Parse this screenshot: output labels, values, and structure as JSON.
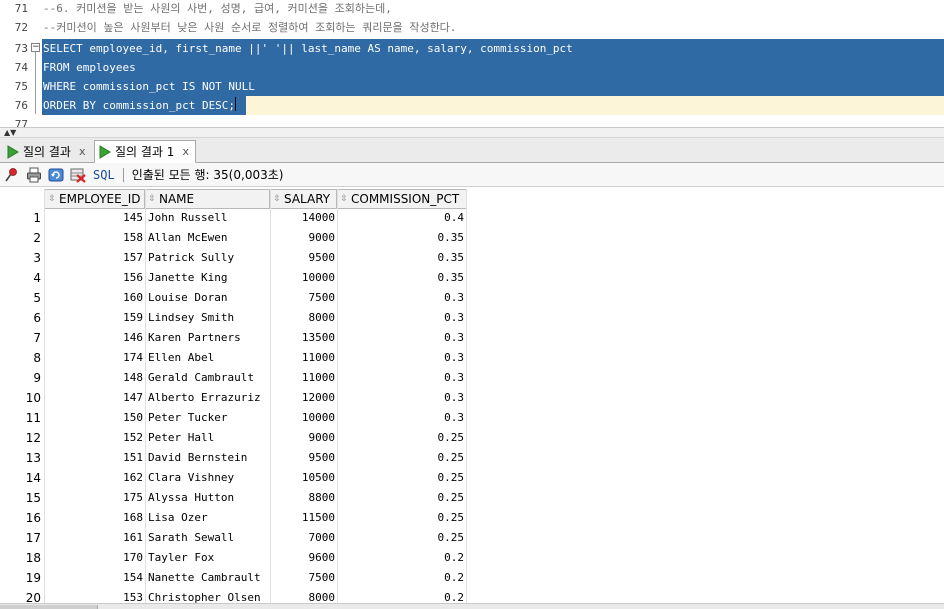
{
  "editor": {
    "lines": [
      {
        "num": "71",
        "text": "--6. 커미션을 받는 사원의 사번, 성명, 급여, 커미션을 조회하는데,",
        "kind": "comment"
      },
      {
        "num": "72",
        "text": "--커미션이 높은 사원부터 낮은 사원 순서로 정렬하여 조회하는 쿼리문을 작성한다.",
        "kind": "comment"
      },
      {
        "num": "73",
        "text": "SELECT employee_id, first_name ||' '|| last_name AS name, salary, commission_pct",
        "kind": "selected"
      },
      {
        "num": "74",
        "text": "FROM employees",
        "kind": "selected"
      },
      {
        "num": "75",
        "text": "WHERE commission_pct IS NOT NULL",
        "kind": "selected"
      },
      {
        "num": "76",
        "text": "ORDER BY commission_pct DESC;",
        "kind": "selected"
      },
      {
        "num": "77",
        "text": "",
        "kind": "plain"
      }
    ],
    "fold_symbol": "−"
  },
  "tabs": [
    {
      "label": "질의 결과",
      "close": "x",
      "active": false
    },
    {
      "label": "질의 결과 1",
      "close": "x",
      "active": true
    }
  ],
  "toolbar": {
    "sql_label": "SQL",
    "status": "인출된 모든 행: 35(0,003초)"
  },
  "grid": {
    "columns": [
      "EMPLOYEE_ID",
      "NAME",
      "SALARY",
      "COMMISSION_PCT"
    ],
    "rows": [
      {
        "n": "1",
        "id": "145",
        "name": "John Russell",
        "salary": "14000",
        "pct": "0.4"
      },
      {
        "n": "2",
        "id": "158",
        "name": "Allan McEwen",
        "salary": "9000",
        "pct": "0.35"
      },
      {
        "n": "3",
        "id": "157",
        "name": "Patrick Sully",
        "salary": "9500",
        "pct": "0.35"
      },
      {
        "n": "4",
        "id": "156",
        "name": "Janette King",
        "salary": "10000",
        "pct": "0.35"
      },
      {
        "n": "5",
        "id": "160",
        "name": "Louise Doran",
        "salary": "7500",
        "pct": "0.3"
      },
      {
        "n": "6",
        "id": "159",
        "name": "Lindsey Smith",
        "salary": "8000",
        "pct": "0.3"
      },
      {
        "n": "7",
        "id": "146",
        "name": "Karen Partners",
        "salary": "13500",
        "pct": "0.3"
      },
      {
        "n": "8",
        "id": "174",
        "name": "Ellen Abel",
        "salary": "11000",
        "pct": "0.3"
      },
      {
        "n": "9",
        "id": "148",
        "name": "Gerald Cambrault",
        "salary": "11000",
        "pct": "0.3"
      },
      {
        "n": "10",
        "id": "147",
        "name": "Alberto Errazuriz",
        "salary": "12000",
        "pct": "0.3"
      },
      {
        "n": "11",
        "id": "150",
        "name": "Peter Tucker",
        "salary": "10000",
        "pct": "0.3"
      },
      {
        "n": "12",
        "id": "152",
        "name": "Peter Hall",
        "salary": "9000",
        "pct": "0.25"
      },
      {
        "n": "13",
        "id": "151",
        "name": "David Bernstein",
        "salary": "9500",
        "pct": "0.25"
      },
      {
        "n": "14",
        "id": "162",
        "name": "Clara Vishney",
        "salary": "10500",
        "pct": "0.25"
      },
      {
        "n": "15",
        "id": "175",
        "name": "Alyssa Hutton",
        "salary": "8800",
        "pct": "0.25"
      },
      {
        "n": "16",
        "id": "168",
        "name": "Lisa Ozer",
        "salary": "11500",
        "pct": "0.25"
      },
      {
        "n": "17",
        "id": "161",
        "name": "Sarath Sewall",
        "salary": "7000",
        "pct": "0.25"
      },
      {
        "n": "18",
        "id": "170",
        "name": "Tayler Fox",
        "salary": "9600",
        "pct": "0.2"
      },
      {
        "n": "19",
        "id": "154",
        "name": "Nanette Cambrault",
        "salary": "7500",
        "pct": "0.2"
      },
      {
        "n": "20",
        "id": "153",
        "name": "Christopher Olsen",
        "salary": "8000",
        "pct": "0.2"
      }
    ]
  },
  "colors": {
    "selection": "#2f6aa4",
    "current_line": "#fdf5d8",
    "comment": "#6f6f6f",
    "play_green": "#3aa335"
  }
}
